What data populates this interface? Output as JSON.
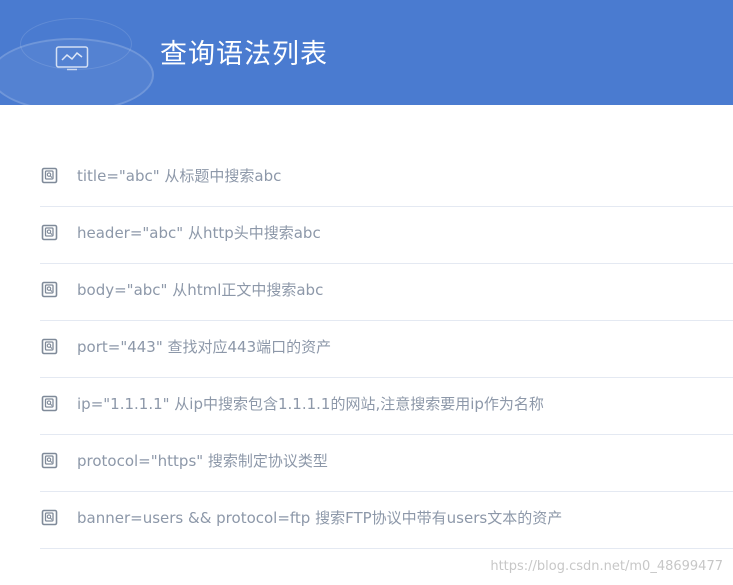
{
  "header": {
    "title": "查询语法列表",
    "icon": "monitor-chart-icon",
    "background": "#4a7bd0"
  },
  "list": {
    "items": [
      {
        "text": "title=\"abc\" 从标题中搜索abc"
      },
      {
        "text": "header=\"abc\" 从http头中搜索abc"
      },
      {
        "text": "body=\"abc\" 从html正文中搜索abc"
      },
      {
        "text": "port=\"443\" 查找对应443端口的资产"
      },
      {
        "text": "ip=\"1.1.1.1\" 从ip中搜索包含1.1.1.1的网站,注意搜索要用ip作为名称"
      },
      {
        "text": "protocol=\"https\" 搜索制定协议类型"
      },
      {
        "text": "banner=users && protocol=ftp 搜索FTP协议中带有users文本的资产"
      }
    ],
    "item_icon": "book-search-icon",
    "text_color": "#8d98a9",
    "divider_color": "#e4e9f2"
  },
  "watermark": {
    "text": "https://blog.csdn.net/m0_48699477"
  }
}
